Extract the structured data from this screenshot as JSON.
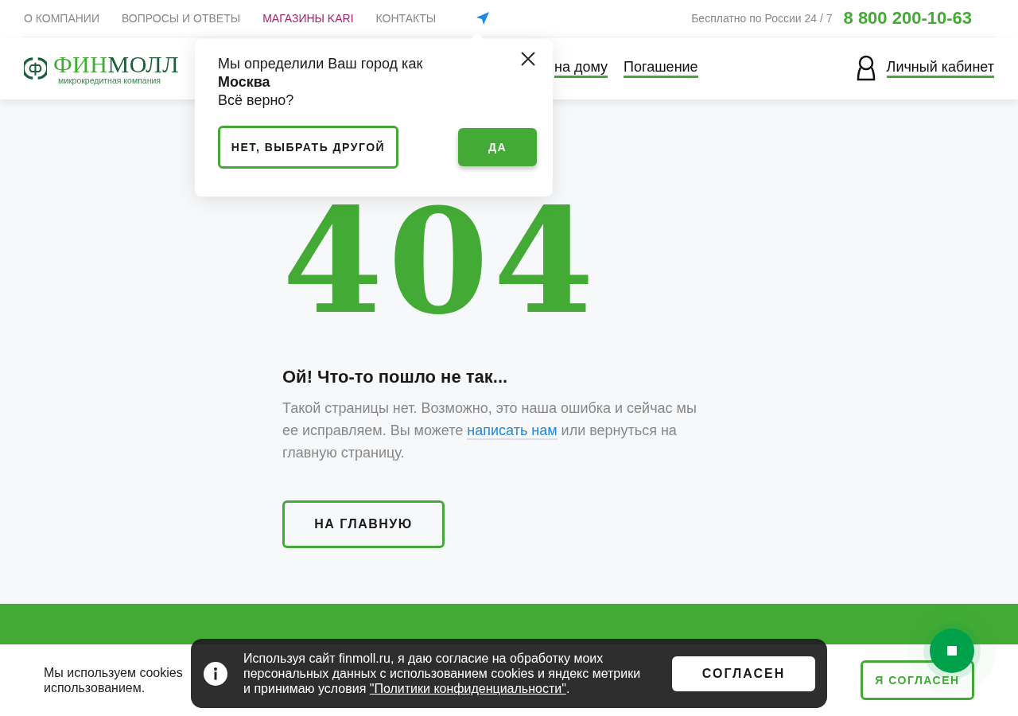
{
  "top_nav": [
    {
      "label": "О КОМПАНИИ",
      "kind": "link"
    },
    {
      "label": "ВОПРОСЫ И ОТВЕТЫ",
      "kind": "link"
    },
    {
      "label": "МАГАЗИНЫ KARI",
      "kind": "partner"
    },
    {
      "label": "КОНТАКТЫ",
      "kind": "link"
    }
  ],
  "hotline": {
    "caption": "Бесплатно по России 24 / 7",
    "phone": "8 800 200-10-63"
  },
  "logo": {
    "name_parts": [
      "ФИН",
      "МОЛЛ"
    ],
    "tagline": "микрокредитная компания"
  },
  "main_nav": [
    "на дому",
    "Погашение"
  ],
  "account": {
    "label": "Личный кабинет"
  },
  "city_popup": {
    "message": "Мы определили Ваш город как",
    "city": "Москва",
    "question": "Всё верно?",
    "buttons": [
      {
        "label": "НЕТ, ВЫБРАТЬ ДРУГОЙ",
        "kind": "outline"
      },
      {
        "label": "ДА",
        "kind": "primary"
      }
    ]
  },
  "error": {
    "code": "404",
    "title": "Ой! Что-то пошло не так...",
    "text_before": "Такой страницы нет. Возможно, это наша ошибка и сейчас мы ее исправляем. Вы можете ",
    "link": "написать нам",
    "text_after": " или вернуться на главную страницу.",
    "button": "НА ГЛАВНУЮ"
  },
  "cookie_notice": {
    "line_1": "Мы используем cookies",
    "line_2": "использованием.",
    "button": "Я СОГЛАСЕН"
  },
  "consent_toast": {
    "text": "Используя сайт finmoll.ru, я даю согласие на обработку моих персональных данных с использованием cookies и яндекс метрики и принимаю условия ",
    "link": "\"Политики конфиденциальности\"",
    "end": ".",
    "button": "СОГЛАСЕН"
  }
}
